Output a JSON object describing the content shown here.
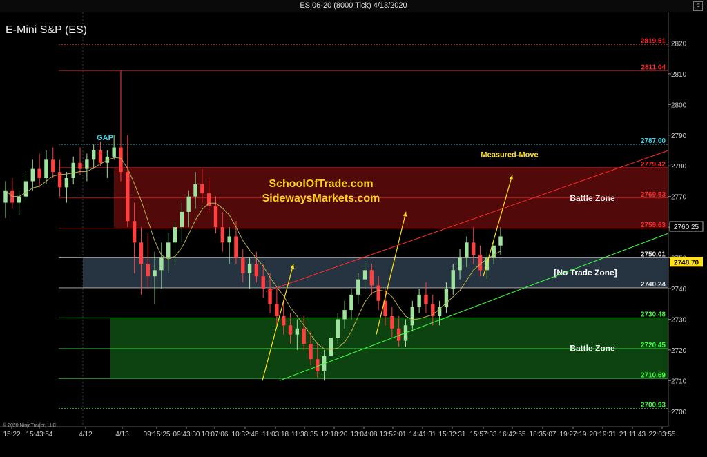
{
  "window": {
    "title": "ES 06-20 (8000 Tick)  4/13/2020",
    "f_label": "F"
  },
  "instrument": "E-Mini S&P (ES)",
  "copyright": "© 2020 NinjaTrader, LLC",
  "watermark": [
    "SchoolOfTrade.com",
    "SidewaysMarkets.com"
  ],
  "colors": {
    "red": "#ff2a2a",
    "green": "#3cff3c",
    "cyan": "#3ad8e8",
    "yellow": "#ffe11a",
    "bull": "#9fe39f",
    "bear": "#ff4040",
    "ma": "#b8b04a"
  },
  "chart_data": {
    "type": "candlestick",
    "ylim": [
      2695,
      2830
    ],
    "y_ticks": [
      2700,
      2710,
      2720,
      2730,
      2740,
      2750,
      2760,
      2770,
      2780,
      2790,
      2800,
      2810,
      2820
    ],
    "x_tick_labels": [
      "15:22",
      "15:43:54",
      "4/12",
      "4/13",
      "09:15:25",
      "09:43:30",
      "10:07:06",
      "10:32:46",
      "11:03:18",
      "11:38:35",
      "12:18:20",
      "13:04:08",
      "13:52:01",
      "14:41:31",
      "15:32:31",
      "15:57:33",
      "16:42:55",
      "18:35:07",
      "19:27:19",
      "20:19:31",
      "21:11:43",
      "22:03:55"
    ],
    "levels": [
      {
        "price": 2819.51,
        "label": "2819.51",
        "color": "#ff2a2a",
        "style": "dotted"
      },
      {
        "price": 2811.04,
        "label": "2811.04",
        "color": "#ff2a2a",
        "style": "solid"
      },
      {
        "price": 2787.0,
        "label": "2787.00",
        "color": "#3ad8e8",
        "style": "dotted"
      },
      {
        "price": 2779.42,
        "label": "2779.42",
        "color": "#ff2a2a",
        "style": "solid"
      },
      {
        "price": 2769.53,
        "label": "2769.53",
        "color": "#ff2a2a",
        "style": "solid"
      },
      {
        "price": 2759.63,
        "label": "2759.63",
        "color": "#ff2a2a",
        "style": "solid"
      },
      {
        "price": 2750.01,
        "label": "2750.01",
        "color": "#e6e6e6",
        "style": "solid"
      },
      {
        "price": 2740.24,
        "label": "2740.24",
        "color": "#e6e6e6",
        "style": "solid"
      },
      {
        "price": 2730.48,
        "label": "2730.48",
        "color": "#3cff3c",
        "style": "solid"
      },
      {
        "price": 2720.45,
        "label": "2720.45",
        "color": "#3cff3c",
        "style": "solid"
      },
      {
        "price": 2710.69,
        "label": "2710.69",
        "color": "#3cff3c",
        "style": "solid"
      },
      {
        "price": 2700.93,
        "label": "2700.93",
        "color": "#3cff3c",
        "style": "dotted"
      }
    ],
    "zones": [
      {
        "name": "Battle Zone",
        "from": 2759.63,
        "to": 2779.42,
        "color": "#5a0a0a"
      },
      {
        "name": "[No Trade Zone]",
        "from": 2740.24,
        "to": 2750.01,
        "color": "#2a3a48"
      },
      {
        "name": "Battle Zone",
        "from": 2710.69,
        "to": 2730.48,
        "color": "#0d4a12"
      }
    ],
    "annotations": {
      "gap": "GAP",
      "measured_move": "Measured-Move"
    },
    "last_price": "2760.25",
    "current_price": "2748.70",
    "candles": [
      [
        2768,
        2775,
        2763,
        2772
      ],
      [
        2772,
        2776,
        2766,
        2768
      ],
      [
        2768,
        2772,
        2764,
        2770
      ],
      [
        2770,
        2778,
        2768,
        2775
      ],
      [
        2775,
        2782,
        2772,
        2779
      ],
      [
        2779,
        2784,
        2773,
        2776
      ],
      [
        2776,
        2785,
        2774,
        2782
      ],
      [
        2782,
        2786,
        2776,
        2778
      ],
      [
        2778,
        2782,
        2770,
        2773
      ],
      [
        2773,
        2778,
        2768,
        2776
      ],
      [
        2776,
        2783,
        2774,
        2781
      ],
      [
        2781,
        2786,
        2777,
        2779
      ],
      [
        2779,
        2784,
        2775,
        2782
      ],
      [
        2782,
        2787,
        2779,
        2785
      ],
      [
        2785,
        2788,
        2780,
        2781
      ],
      [
        2781,
        2785,
        2776,
        2783
      ],
      [
        2783,
        2790,
        2782,
        2786
      ],
      [
        2786,
        2811,
        2775,
        2778
      ],
      [
        2778,
        2790,
        2760,
        2762
      ],
      [
        2762,
        2768,
        2745,
        2755
      ],
      [
        2755,
        2760,
        2738,
        2748
      ],
      [
        2748,
        2758,
        2740,
        2744
      ],
      [
        2744,
        2752,
        2735,
        2746
      ],
      [
        2746,
        2755,
        2740,
        2750
      ],
      [
        2750,
        2758,
        2745,
        2755
      ],
      [
        2755,
        2762,
        2748,
        2760
      ],
      [
        2760,
        2768,
        2755,
        2765
      ],
      [
        2765,
        2772,
        2760,
        2770
      ],
      [
        2770,
        2778,
        2766,
        2774
      ],
      [
        2774,
        2779,
        2768,
        2771
      ],
      [
        2771,
        2776,
        2765,
        2767
      ],
      [
        2767,
        2770,
        2758,
        2760
      ],
      [
        2760,
        2765,
        2752,
        2755
      ],
      [
        2755,
        2760,
        2748,
        2757
      ],
      [
        2757,
        2762,
        2748,
        2750
      ],
      [
        2750,
        2753,
        2742,
        2745
      ],
      [
        2745,
        2750,
        2740,
        2748
      ],
      [
        2748,
        2752,
        2742,
        2744
      ],
      [
        2744,
        2748,
        2737,
        2740
      ],
      [
        2740,
        2745,
        2732,
        2735
      ],
      [
        2735,
        2740,
        2728,
        2731
      ],
      [
        2731,
        2736,
        2725,
        2728
      ],
      [
        2728,
        2732,
        2722,
        2725
      ],
      [
        2725,
        2730,
        2720,
        2727
      ],
      [
        2727,
        2731,
        2720,
        2722
      ],
      [
        2722,
        2726,
        2715,
        2717
      ],
      [
        2717,
        2722,
        2711,
        2713
      ],
      [
        2713,
        2720,
        2710,
        2718
      ],
      [
        2718,
        2726,
        2716,
        2724
      ],
      [
        2724,
        2732,
        2722,
        2730
      ],
      [
        2730,
        2736,
        2727,
        2733
      ],
      [
        2733,
        2740,
        2730,
        2738
      ],
      [
        2738,
        2745,
        2735,
        2743
      ],
      [
        2743,
        2749,
        2740,
        2746
      ],
      [
        2746,
        2748,
        2738,
        2741
      ],
      [
        2741,
        2744,
        2733,
        2736
      ],
      [
        2736,
        2740,
        2728,
        2731
      ],
      [
        2731,
        2734,
        2724,
        2727
      ],
      [
        2727,
        2731,
        2721,
        2723
      ],
      [
        2723,
        2730,
        2721,
        2728
      ],
      [
        2728,
        2736,
        2726,
        2734
      ],
      [
        2734,
        2740,
        2732,
        2738
      ],
      [
        2738,
        2742,
        2732,
        2735
      ],
      [
        2735,
        2738,
        2728,
        2731
      ],
      [
        2731,
        2736,
        2728,
        2734
      ],
      [
        2734,
        2742,
        2732,
        2740
      ],
      [
        2740,
        2748,
        2738,
        2746
      ],
      [
        2746,
        2753,
        2743,
        2750
      ],
      [
        2750,
        2757,
        2747,
        2755
      ],
      [
        2755,
        2760,
        2748,
        2751
      ],
      [
        2751,
        2754,
        2744,
        2746
      ],
      [
        2746,
        2752,
        2743,
        2750
      ],
      [
        2750,
        2756,
        2748,
        2754
      ],
      [
        2754,
        2760,
        2751,
        2757
      ]
    ]
  }
}
